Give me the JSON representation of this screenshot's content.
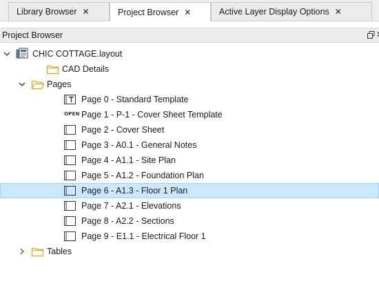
{
  "tabs": [
    {
      "label": "Library Browser",
      "close": "✕"
    },
    {
      "label": "Project Browser",
      "close": "✕"
    },
    {
      "label": "Active Layer Display Options",
      "close": "✕"
    }
  ],
  "panel": {
    "title": "Project Browser"
  },
  "tree": {
    "root": "CHIC COTTAGE.layout",
    "cad_details": "CAD Details",
    "pages_folder": "Pages",
    "pages": [
      "Page 0 - Standard Template",
      "Page 1 - P-1 - Cover Sheet Template",
      "Page 2 - Cover Sheet",
      "Page 3 - A0.1 - General Notes",
      "Page 4 - A1.1 - Site Plan",
      "Page 5 - A1.2 - Foundation Plan",
      "Page 6 - A1.3 - Floor 1 Plan",
      "Page 7 - A2.1 - Elevations",
      "Page 8 - A2.2 - Sections",
      "Page 9 - E1.1 - Electrical Floor 1"
    ],
    "tables": "Tables",
    "open_badge": "OPEN",
    "selected_page_index": 6
  },
  "colors": {
    "selection_bg": "#cce8ff",
    "selection_border": "#99d1ff",
    "folder": "#d9a520"
  }
}
